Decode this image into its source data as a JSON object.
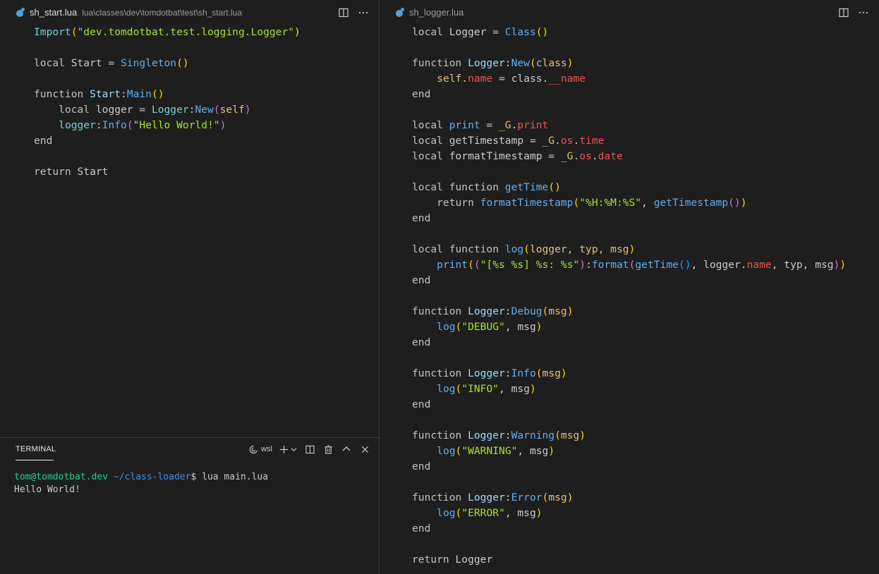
{
  "left_editor": {
    "tab_name": "sh_start.lua",
    "tab_path": "lua\\classes\\dev\\tomdotbat\\test\\sh_start.lua",
    "code": {
      "l1": {
        "a": "Import",
        "b": "(",
        "c": "\"dev.tomdotbat.test.logging.Logger\"",
        "d": ")"
      },
      "l2": {
        "a": "local ",
        "b": "Start",
        "c": " = ",
        "d": "Singleton",
        "e": "()"
      },
      "l3": {
        "a": "function ",
        "b": "Start",
        "c": ":",
        "d": "Main",
        "e": "()"
      },
      "l4": {
        "a": "    local ",
        "b": "logger",
        "c": " = ",
        "d": "Logger",
        "e": ":",
        "f": "New",
        "g": "(",
        "h": "self",
        "i": ")"
      },
      "l5": {
        "a": "    ",
        "b": "logger",
        "c": ":",
        "d": "Info",
        "e": "(",
        "f": "\"Hello World!\"",
        "g": ")"
      },
      "l6": {
        "a": "end"
      },
      "l7": {
        "a": "return ",
        "b": "Start"
      }
    }
  },
  "right_editor": {
    "tab_name": "sh_logger.lua",
    "code": {
      "r1": {
        "a": "local ",
        "b": "Logger",
        "c": " = ",
        "d": "Class",
        "e": "()"
      },
      "r2": {
        "a": "function ",
        "b": "Logger",
        "c": ":",
        "d": "New",
        "e": "(",
        "f": "class",
        "g": ")"
      },
      "r3": {
        "a": "    ",
        "b": "self",
        "c": ".",
        "d": "name",
        "e": " = class.",
        "f": "__name"
      },
      "r4": {
        "a": "end"
      },
      "r5": {
        "a": "local ",
        "b": "print",
        "c": " = ",
        "d": "_G",
        "e": ".",
        "f": "print"
      },
      "r6": {
        "a": "local ",
        "b": "getTimestamp",
        "c": " = ",
        "d": "_G",
        "e": ".",
        "f": "os",
        "g": ".",
        "h": "time"
      },
      "r7": {
        "a": "local ",
        "b": "formatTimestamp",
        "c": " = ",
        "d": "_G",
        "e": ".",
        "f": "os",
        "g": ".",
        "h": "date"
      },
      "r8": {
        "a": "local function ",
        "b": "getTime",
        "c": "()"
      },
      "r9": {
        "a": "    return ",
        "b": "formatTimestamp",
        "c": "(",
        "d": "\"%H:%M:%S\"",
        "e": ", ",
        "f": "getTimestamp",
        "g": "()",
        "h": ")"
      },
      "r10": {
        "a": "end"
      },
      "r11": {
        "a": "local function ",
        "b": "log",
        "c": "(",
        "d": "logger, typ, msg",
        "e": ")"
      },
      "r12": {
        "a": "    ",
        "b": "print",
        "c": "(",
        "d": "(",
        "e": "\"[%s %s] %s: %s\"",
        "f": ")",
        "g": ":",
        "h": "format",
        "i": "(",
        "j": "getTime",
        "k": "()",
        "l": ", logger.",
        "m": "name",
        "n": ", typ, msg",
        "o": ")",
        "p": ")"
      },
      "r13": {
        "a": "end"
      },
      "r14": {
        "a": "function ",
        "b": "Logger",
        "c": ":",
        "d": "Debug",
        "e": "(",
        "f": "msg",
        "g": ")"
      },
      "r15": {
        "a": "    ",
        "b": "log",
        "c": "(",
        "d": "\"DEBUG\"",
        "e": ", msg",
        "f": ")"
      },
      "r16": {
        "a": "end"
      },
      "r17": {
        "a": "function ",
        "b": "Logger",
        "c": ":",
        "d": "Info",
        "e": "(",
        "f": "msg",
        "g": ")"
      },
      "r18": {
        "a": "    ",
        "b": "log",
        "c": "(",
        "d": "\"INFO\"",
        "e": ", msg",
        "f": ")"
      },
      "r19": {
        "a": "end"
      },
      "r20": {
        "a": "function ",
        "b": "Logger",
        "c": ":",
        "d": "Warning",
        "e": "(",
        "f": "msg",
        "g": ")"
      },
      "r21": {
        "a": "    ",
        "b": "log",
        "c": "(",
        "d": "\"WARNING\"",
        "e": ", msg",
        "f": ")"
      },
      "r22": {
        "a": "end"
      },
      "r23": {
        "a": "function ",
        "b": "Logger",
        "c": ":",
        "d": "Error",
        "e": "(",
        "f": "msg",
        "g": ")"
      },
      "r24": {
        "a": "    ",
        "b": "log",
        "c": "(",
        "d": "\"ERROR\"",
        "e": ", msg",
        "f": ")"
      },
      "r25": {
        "a": "end"
      },
      "r26": {
        "a": "return ",
        "b": "Logger"
      }
    }
  },
  "terminal": {
    "tab_label": "TERMINAL",
    "shell_label": "wsl",
    "prompt_user": "tom@tomdotbat.dev",
    "prompt_path": " ~/class-loader",
    "prompt_symbol": "$ ",
    "command": "lua main.lua",
    "output": "Hello World!"
  },
  "icons": {
    "file_icon": "lua-icon",
    "split_icon": "split-editor-icon",
    "more_icon": "more-actions-icon"
  }
}
